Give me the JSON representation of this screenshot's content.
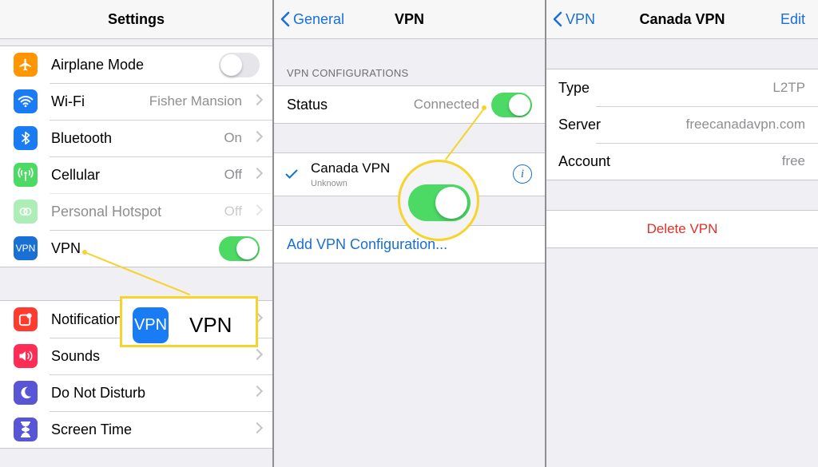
{
  "settings": {
    "title": "Settings",
    "items": [
      {
        "label": "Airplane Mode",
        "icon": "airplane-icon",
        "color": "#ff9500"
      },
      {
        "label": "Wi-Fi",
        "value": "Fisher Mansion",
        "icon": "wifi-icon",
        "color": "#1a7cf5"
      },
      {
        "label": "Bluetooth",
        "value": "On",
        "icon": "bluetooth-icon",
        "color": "#1a7cf5"
      },
      {
        "label": "Cellular",
        "value": "Off",
        "icon": "cellular-icon",
        "color": "#4cd964"
      },
      {
        "label": "Personal Hotspot",
        "value": "Off",
        "icon": "hotspot-icon",
        "color": "#4cd964"
      },
      {
        "label": "VPN",
        "icon_text": "VPN",
        "color": "#1a6fd4"
      }
    ],
    "items2": [
      {
        "label": "Notifications",
        "icon": "notifications-icon",
        "color": "#ff3b30"
      },
      {
        "label": "Sounds",
        "icon": "sounds-icon",
        "color": "#ff2d55"
      },
      {
        "label": "Do Not Disturb",
        "icon": "moon-icon",
        "color": "#5856d6"
      },
      {
        "label": "Screen Time",
        "icon": "hourglass-icon",
        "color": "#5856d6"
      }
    ]
  },
  "callout_vpn": {
    "icon_text": "VPN",
    "label": "VPN"
  },
  "vpn": {
    "back": "General",
    "title": "VPN",
    "section": "VPN CONFIGURATIONS",
    "status_label": "Status",
    "status_value": "Connected",
    "config_name": "Canada VPN",
    "config_sub": "Unknown",
    "add": "Add VPN Configuration..."
  },
  "detail": {
    "back": "VPN",
    "title": "Canada VPN",
    "edit": "Edit",
    "rows": [
      {
        "label": "Type",
        "value": "L2TP"
      },
      {
        "label": "Server",
        "value": "freecanadavpn.com"
      },
      {
        "label": "Account",
        "value": "free"
      }
    ],
    "delete": "Delete VPN"
  },
  "colors": {
    "accent": "#1a6fd4",
    "toggle_on": "#4cd964",
    "callout": "#f6d32d",
    "destructive": "#e0302a"
  }
}
